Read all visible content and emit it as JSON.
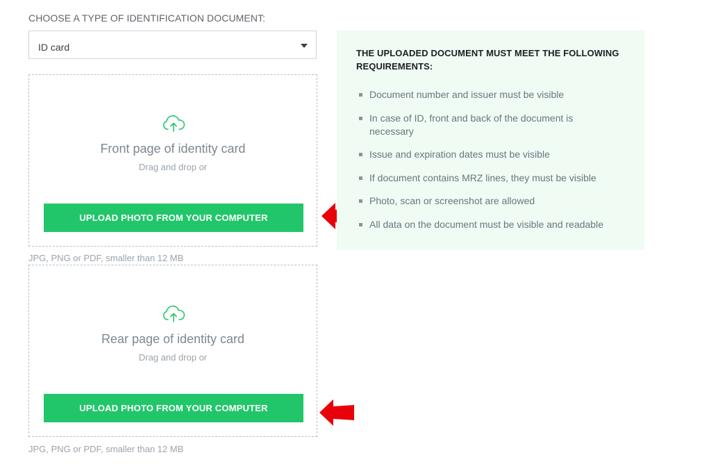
{
  "doc_type": {
    "label": "CHOOSE A TYPE OF IDENTIFICATION DOCUMENT:",
    "selected": "ID card"
  },
  "uploads": [
    {
      "title": "Front page of identity card",
      "subtitle": "Drag and drop or",
      "button_label": "UPLOAD PHOTO FROM YOUR COMPUTER",
      "hint": "JPG, PNG or PDF, smaller than 12 MB"
    },
    {
      "title": "Rear page of identity card",
      "subtitle": "Drag and drop or",
      "button_label": "UPLOAD PHOTO FROM YOUR COMPUTER",
      "hint": "JPG, PNG or PDF, smaller than 12 MB"
    }
  ],
  "requirements": {
    "title": "THE UPLOADED DOCUMENT MUST MEET THE FOLLOWING REQUIREMENTS:",
    "items": [
      "Document number and issuer must be visible",
      "In case of ID, front and back of the document is necessary",
      "Issue and expiration dates must be visible",
      "If document contains MRZ lines, they must be visible",
      "Photo, scan or screenshot are allowed",
      "All data on the document must be visible and readable"
    ]
  },
  "colors": {
    "accent": "#22c66a",
    "panel_bg": "#effbf3",
    "annotation_arrow": "#e8000b"
  },
  "icons": {
    "upload": "cloud-upload-icon",
    "dropdown": "chevron-down-icon",
    "annotation": "arrow-left-icon"
  }
}
